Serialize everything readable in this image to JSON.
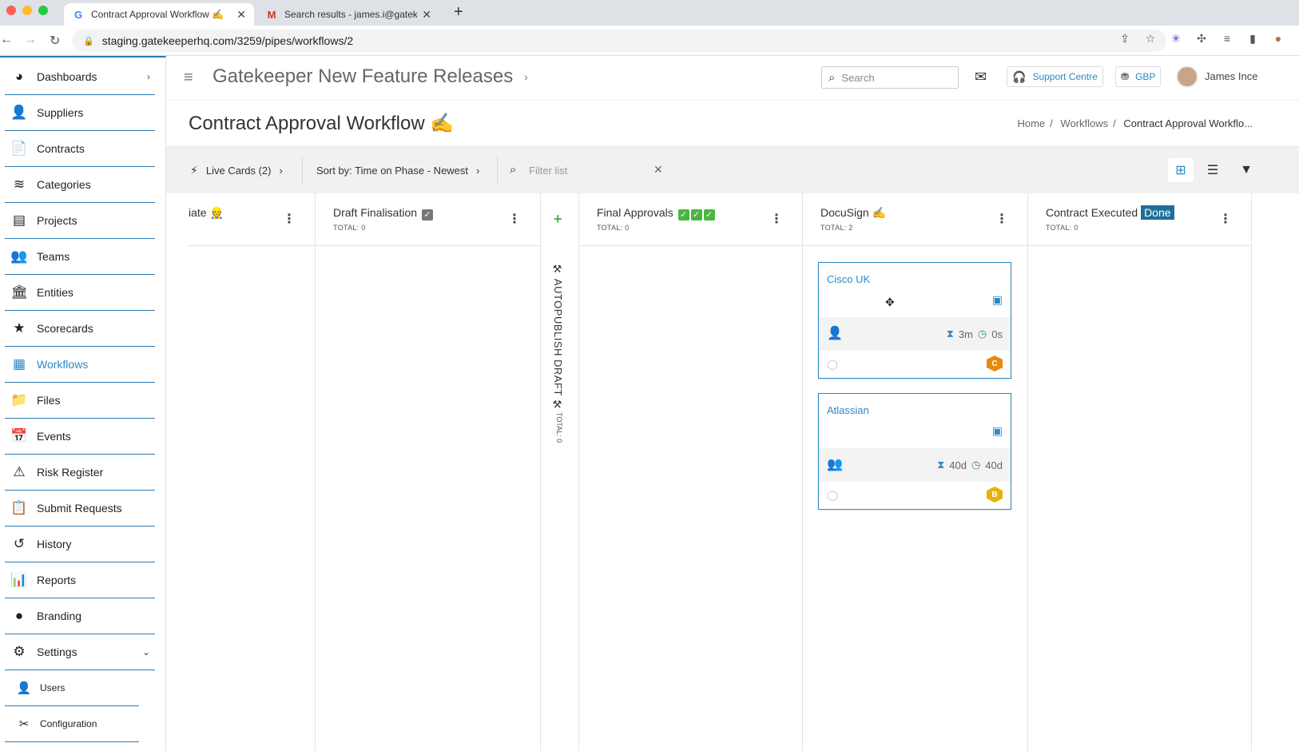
{
  "browser": {
    "tabs": [
      {
        "title": "Contract Approval Workflow ✍️",
        "favicon": "G",
        "active": true
      },
      {
        "title": "Search results - james.i@gatek",
        "favicon": "M",
        "active": false
      }
    ],
    "url": "staging.gatekeeperhq.com/3259/pipes/workflows/2"
  },
  "sidebar": {
    "items": [
      {
        "label": "Dashboards",
        "icon": "dashboard-icon",
        "glyph": "◕"
      },
      {
        "label": "Suppliers",
        "icon": "suppliers-icon",
        "glyph": "👤"
      },
      {
        "label": "Contracts",
        "icon": "contracts-icon",
        "glyph": "📄"
      },
      {
        "label": "Categories",
        "icon": "categories-icon",
        "glyph": "≋"
      },
      {
        "label": "Projects",
        "icon": "projects-icon",
        "glyph": "▤"
      },
      {
        "label": "Teams",
        "icon": "teams-icon",
        "glyph": "👥"
      },
      {
        "label": "Entities",
        "icon": "entities-icon",
        "glyph": "🏛"
      },
      {
        "label": "Scorecards",
        "icon": "scorecards-icon",
        "glyph": "★"
      },
      {
        "label": "Workflows",
        "icon": "workflows-icon",
        "glyph": "▦"
      },
      {
        "label": "Files",
        "icon": "files-icon",
        "glyph": "📁"
      },
      {
        "label": "Events",
        "icon": "events-icon",
        "glyph": "📅"
      },
      {
        "label": "Risk Register",
        "icon": "risk-icon",
        "glyph": "⚠"
      },
      {
        "label": "Submit Requests",
        "icon": "submit-icon",
        "glyph": "📋"
      },
      {
        "label": "History",
        "icon": "history-icon",
        "glyph": "↺"
      },
      {
        "label": "Reports",
        "icon": "reports-icon",
        "glyph": "📊"
      },
      {
        "label": "Branding",
        "icon": "branding-icon",
        "glyph": "●"
      },
      {
        "label": "Settings",
        "icon": "gear-icon",
        "glyph": "⚙"
      }
    ],
    "sub_items": [
      {
        "label": "Users",
        "glyph": "👤"
      },
      {
        "label": "Configuration",
        "glyph": "✂"
      }
    ]
  },
  "header": {
    "title": "Gatekeeper New Feature Releases",
    "search_placeholder": "Search",
    "support_label": "Support Centre",
    "currency": "GBP",
    "user_name": "James Ince"
  },
  "page": {
    "title": "Contract Approval Workflow ✍️",
    "breadcrumb": [
      "Home",
      "Workflows",
      "Contract Approval Workflo..."
    ]
  },
  "toolbar": {
    "live_cards": "Live Cards (2)",
    "sort_by": "Sort by: Time on Phase - Newest",
    "filter_placeholder": "Filter list"
  },
  "board": {
    "columns": [
      {
        "title": "iate 👷",
        "total": ""
      },
      {
        "title": "Draft Finalisation",
        "total": "TOTAL: 0"
      },
      {
        "title": "Final Approvals",
        "total": "TOTAL: 0"
      },
      {
        "title": "DocuSign ✍️",
        "total": "TOTAL: 2"
      },
      {
        "title": "Contract Executed",
        "badge": "Done",
        "total": "TOTAL: 0"
      }
    ],
    "collapsed": {
      "title": "⚒ AUTOPUBLISH DRAFT ⚒",
      "total": "TOTAL: 0"
    },
    "cards": [
      {
        "name": "Cisco UK",
        "time_phase": "3m",
        "time_total": "0s",
        "rating": "C",
        "rating_color": "#e8890c"
      },
      {
        "name": "Atlassian",
        "time_phase": "40d",
        "time_total": "40d",
        "rating": "B",
        "rating_color": "#e6b30e"
      }
    ]
  }
}
